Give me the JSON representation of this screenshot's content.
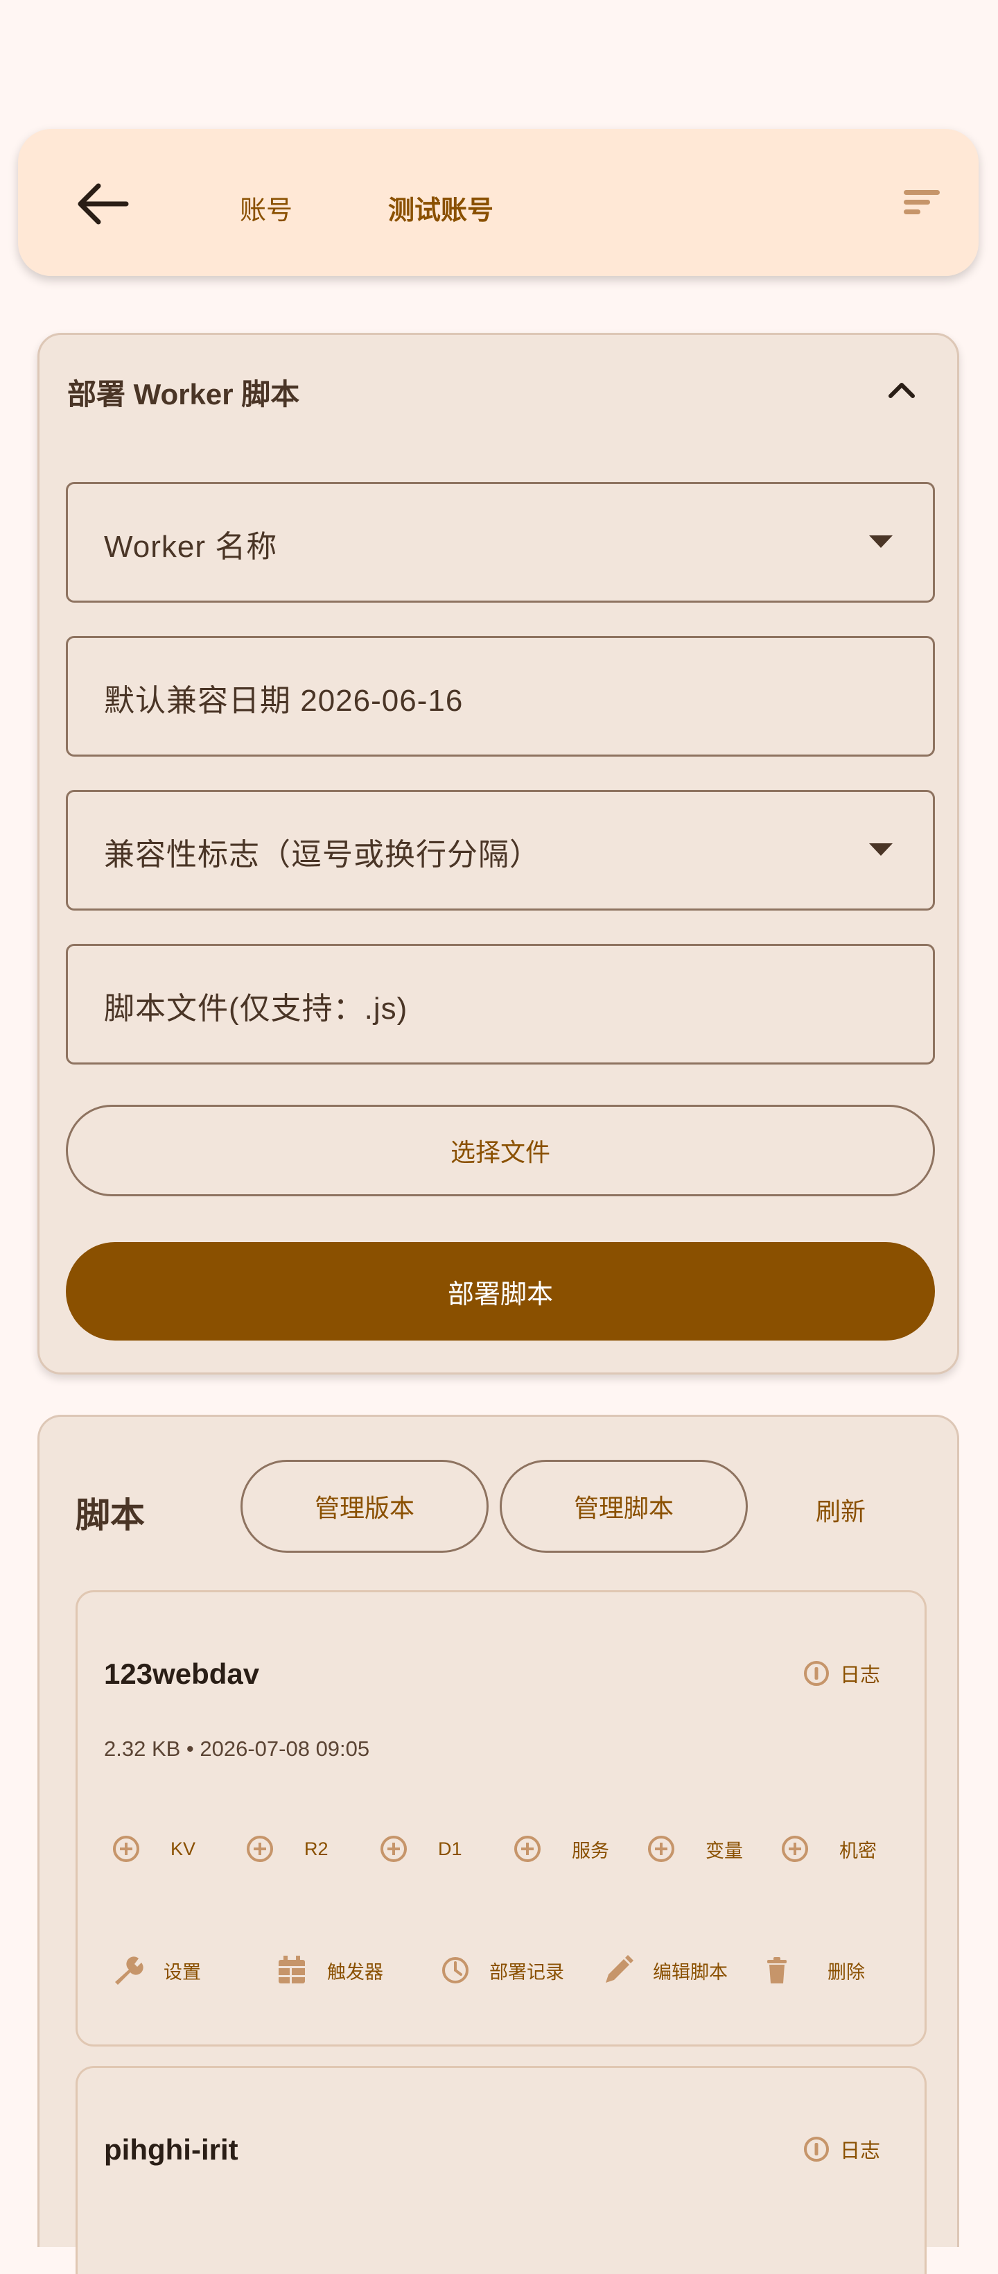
{
  "header": {
    "breadcrumb": [
      "账号",
      "测试账号"
    ]
  },
  "deploy": {
    "title": "部署 Worker 脚本",
    "worker_name_placeholder": "Worker 名称",
    "compat_date_placeholder": "默认兼容日期 2026-06-16",
    "compat_flags_placeholder": "兼容性标志（逗号或换行分隔）",
    "script_file_placeholder": "脚本文件(仅支持：.js)",
    "choose_file_label": "选择文件",
    "deploy_label": "部署脚本"
  },
  "scripts": {
    "title": "脚本",
    "manage_versions_label": "管理版本",
    "manage_scripts_label": "管理脚本",
    "refresh_label": "刷新",
    "items": [
      {
        "name": "123webdav",
        "log_label": "日志",
        "meta": "2.32 KB • 2026-07-08 09:05",
        "bindings": [
          "KV",
          "R2",
          "D1",
          "服务",
          "变量",
          "机密"
        ],
        "actions": [
          "设置",
          "触发器",
          "部署记录",
          "编辑脚本",
          "删除"
        ]
      },
      {
        "name": "pihghi-irit",
        "log_label": "日志"
      }
    ]
  },
  "theme": {
    "accent": "#8a5000",
    "background": "#fff6f3",
    "card": "#f2e5db",
    "topbar": "#ffe8d6"
  },
  "icons": {
    "back": "arrow-left-icon",
    "sort": "sort-icon",
    "collapse": "chevron-up-icon",
    "dropdown": "caret-down-icon",
    "log": "info-circle-icon",
    "add": "plus-circle-icon",
    "settings": "wrench-icon",
    "triggers": "calendar-icon",
    "history": "clock-icon",
    "edit": "pencil-icon",
    "delete": "trash-icon"
  }
}
